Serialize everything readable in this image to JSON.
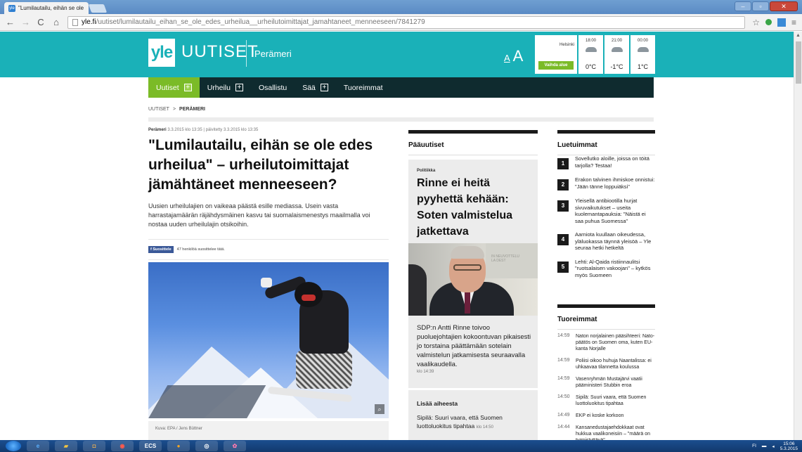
{
  "browser": {
    "tab_title": "\"Lumilautailu, eihän se ole ×",
    "tab_favicon": "yle",
    "url_host": "yle.fi",
    "url_path": "/uutiset/lumilautailu_eihan_se_ole_edes_urheilua__urheilutoimittajat_jamahtaneet_menneeseen/7841279",
    "back_glyph": "←",
    "forward_glyph": "→",
    "reload_glyph": "C",
    "home_glyph": "⌂",
    "star_glyph": "☆",
    "menu_glyph": "≡",
    "minimize_glyph": "–",
    "maximize_glyph": "▫",
    "close_glyph": "✕"
  },
  "header": {
    "logo": "yle",
    "brand": "UUTISET",
    "region": "Perämeri",
    "font_small": "A",
    "font_big": "A"
  },
  "weather": {
    "city": "Helsinki",
    "change_area": "Vaihda alue",
    "slots": [
      {
        "time": "18:00",
        "temp": "0°C",
        "icon": "cloud-icon"
      },
      {
        "time": "21:00",
        "temp": "-1°C",
        "icon": "partly-sunny-icon"
      },
      {
        "time": "00:00",
        "temp": "1°C",
        "icon": "cloud-icon"
      }
    ]
  },
  "nav": {
    "items": [
      {
        "label": "Uutiset",
        "plus": "+"
      },
      {
        "label": "Urheilu",
        "plus": "+"
      },
      {
        "label": "Osallistu"
      },
      {
        "label": "Sää",
        "plus": "+"
      },
      {
        "label": "Tuoreimmat"
      }
    ]
  },
  "breadcrumb": {
    "root": "UUTISET",
    "sep": ">",
    "current": "PERÄMERI"
  },
  "article": {
    "region": "Perämeri",
    "meta": "3.3.2015 klo 13:35  |  päivitetty 3.3.2015 klo 13:35",
    "title": "\"Lumilautailu, eihän se ole edes urheilua\" – urheilutoimittajat jämähtäneet menneeseen?",
    "lead": "Uusien urheilulajien on vaikeaa päästä esille mediassa. Usein vasta harrastajamäärän räjähdysmäinen kasvu tai suomalaismenestys maailmalla voi nostaa uuden urheilulajin otsikoihin.",
    "fb_button": "f Suosittele",
    "fb_count": "47 henkilöä suosittelee tätä.",
    "photo_caption": "Kuva: EPA / Jens Büttner"
  },
  "main_news": {
    "heading": "Pääuutiset",
    "category": "Politiikka",
    "title": "Rinne ei heitä pyyhettä kehään: Soten valmistelua jatkettava",
    "photo_wall_text": "IN NEUVOTTELU\nLA DEST",
    "text": "SDP:n Antti Rinne toivoo puoluejohtajien kokoontuvan pikaisesti jo torstaina päättämään sotelain valmistelun jatkamisesta seuraavalla vaalikaudella.",
    "time": "klo 14:39",
    "more_heading": "Lisää aiheesta",
    "more_link": "Sipilä: Suuri vaara, että Suomen luottoluokitus tipahtaa",
    "more_time": "klo 14:50"
  },
  "most_read": {
    "heading": "Luetuimmat",
    "items": [
      {
        "num": "1",
        "text": "Sovellutko aloille, joissa on töitä tarjolla? Testaa!"
      },
      {
        "num": "2",
        "text": "Erakon talvinen ihmiskoe onnistui: \"Jään tänne loppuiäksi\""
      },
      {
        "num": "3",
        "text": "Yleisellä antibiootilla hurjat sivuvaikutukset – useita kuolemantapauksia: \"Näistä ei saa puhua Suomessa\""
      },
      {
        "num": "4",
        "text": "Aarniota kuullaan oikeudessa, yläluokassa täynnä yleisöä – Yle seuraa hetki hetkeltä"
      },
      {
        "num": "5",
        "text": "Lehti: Al-Qaida ristiinnaulitsi \"ruotsalaisen vakoojan\" – kytkös myös Suomeen"
      }
    ]
  },
  "latest": {
    "heading": "Tuoreimmat",
    "items": [
      {
        "time": "14:59",
        "text": "Naton norjalainen pääsihteeri: Nato-päätös on Suomen oma, kuten EU-kanta Norjalle"
      },
      {
        "time": "14:59",
        "text": "Poliisi oikoo huhuja Naantalissa: ei uhkaavaa tilannetta koulussa"
      },
      {
        "time": "14:59",
        "text": "Vasenryhmän Mustajärvi vaatii pääministeri Stubbin eroa"
      },
      {
        "time": "14:50",
        "text": "Sipilä: Suuri vaara, että Suomen luottoluokitus tipahtaa"
      },
      {
        "time": "14:49",
        "text": "EKP ei koske korkoon"
      },
      {
        "time": "14:44",
        "text": "Kansanedustajaehdokkaat ovat hukkua vaalikoneisiin – \"määrä on tyrmistyttävä\""
      }
    ]
  },
  "taskbar": {
    "icons": [
      "ie-icon",
      "folder-icon",
      "outlook-icon",
      "chrome-icon",
      "ecs-icon",
      "winamp-icon",
      "media-icon",
      "paint-icon"
    ],
    "ecs_label": "ECS",
    "tray_lang": "FI",
    "clock_time": "15:06",
    "clock_date": "5.3.2015"
  }
}
